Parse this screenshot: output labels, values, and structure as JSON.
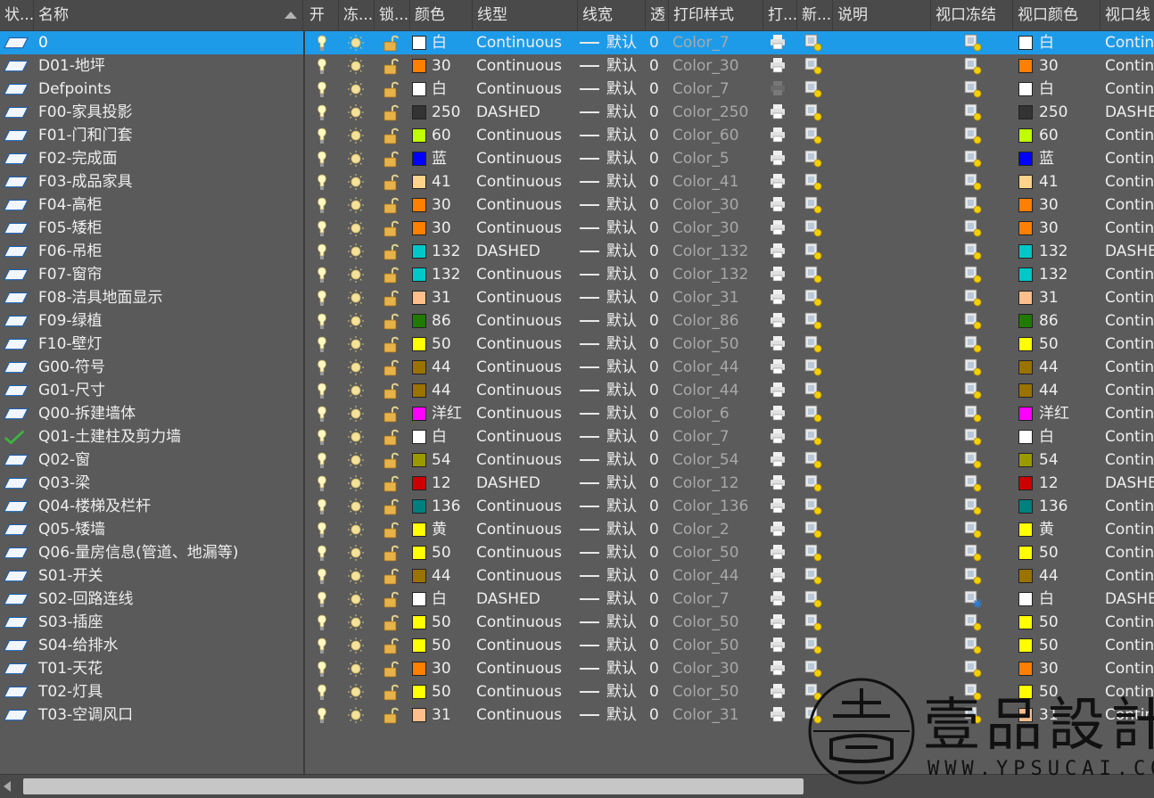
{
  "columns": {
    "status": "状...",
    "name": "名称",
    "on": "开",
    "freeze": "冻...",
    "lock": "锁...",
    "color": "颜色",
    "linetype": "线型",
    "lineweight": "线宽",
    "transparency": "透",
    "plot_style": "打印样式",
    "plot": "打...",
    "new_vp_freeze": "新...",
    "description": "说明",
    "vp_freeze": "视口冻结",
    "vp_color": "视口颜色",
    "vp_linetype": "视口线"
  },
  "layers": [
    {
      "name": "0",
      "color_label": "白",
      "hex": "#ffffff",
      "linetype": "Continuous",
      "lineweight": "默认",
      "transparency": "0",
      "plot_style": "Color_7",
      "vp_color_label": "白",
      "vp_linetype": "Contin",
      "selected": true
    },
    {
      "name": "D01-地坪",
      "color_label": "30",
      "hex": "#ff7f00",
      "linetype": "Continuous",
      "lineweight": "默认",
      "transparency": "0",
      "plot_style": "Color_30",
      "vp_color_label": "30",
      "vp_linetype": "Contin"
    },
    {
      "name": "Defpoints",
      "color_label": "白",
      "hex": "#ffffff",
      "linetype": "Continuous",
      "lineweight": "默认",
      "transparency": "0",
      "plot_style": "Color_7",
      "vp_color_label": "白",
      "vp_linetype": "Contin",
      "no_plot": true
    },
    {
      "name": "F00-家具投影",
      "color_label": "250",
      "hex": "#333333",
      "linetype": "DASHED",
      "lineweight": "默认",
      "transparency": "0",
      "plot_style": "Color_250",
      "vp_color_label": "250",
      "vp_linetype": "DASHE"
    },
    {
      "name": "F01-门和门套",
      "color_label": "60",
      "hex": "#bfff00",
      "linetype": "Continuous",
      "lineweight": "默认",
      "transparency": "0",
      "plot_style": "Color_60",
      "vp_color_label": "60",
      "vp_linetype": "Contin"
    },
    {
      "name": "F02-完成面",
      "color_label": "蓝",
      "hex": "#0000ff",
      "linetype": "Continuous",
      "lineweight": "默认",
      "transparency": "0",
      "plot_style": "Color_5",
      "vp_color_label": "蓝",
      "vp_linetype": "Contin"
    },
    {
      "name": "F03-成品家具",
      "color_label": "41",
      "hex": "#ffd38a",
      "linetype": "Continuous",
      "lineweight": "默认",
      "transparency": "0",
      "plot_style": "Color_41",
      "vp_color_label": "41",
      "vp_linetype": "Contin"
    },
    {
      "name": "F04-高柜",
      "color_label": "30",
      "hex": "#ff7f00",
      "linetype": "Continuous",
      "lineweight": "默认",
      "transparency": "0",
      "plot_style": "Color_30",
      "vp_color_label": "30",
      "vp_linetype": "Contin"
    },
    {
      "name": "F05-矮柜",
      "color_label": "30",
      "hex": "#ff7f00",
      "linetype": "Continuous",
      "lineweight": "默认",
      "transparency": "0",
      "plot_style": "Color_30",
      "vp_color_label": "30",
      "vp_linetype": "Contin"
    },
    {
      "name": "F06-吊柜",
      "color_label": "132",
      "hex": "#00c8c8",
      "linetype": "DASHED",
      "lineweight": "默认",
      "transparency": "0",
      "plot_style": "Color_132",
      "vp_color_label": "132",
      "vp_linetype": "DASHE"
    },
    {
      "name": "F07-窗帘",
      "color_label": "132",
      "hex": "#00c8c8",
      "linetype": "Continuous",
      "lineweight": "默认",
      "transparency": "0",
      "plot_style": "Color_132",
      "vp_color_label": "132",
      "vp_linetype": "Contin"
    },
    {
      "name": "F08-洁具地面显示",
      "color_label": "31",
      "hex": "#ffbf8c",
      "linetype": "Continuous",
      "lineweight": "默认",
      "transparency": "0",
      "plot_style": "Color_31",
      "vp_color_label": "31",
      "vp_linetype": "Contin"
    },
    {
      "name": "F09-绿植",
      "color_label": "86",
      "hex": "#207a00",
      "linetype": "Continuous",
      "lineweight": "默认",
      "transparency": "0",
      "plot_style": "Color_86",
      "vp_color_label": "86",
      "vp_linetype": "Contin"
    },
    {
      "name": "F10-壁灯",
      "color_label": "50",
      "hex": "#ffff00",
      "linetype": "Continuous",
      "lineweight": "默认",
      "transparency": "0",
      "plot_style": "Color_50",
      "vp_color_label": "50",
      "vp_linetype": "Contin"
    },
    {
      "name": "G00-符号",
      "color_label": "44",
      "hex": "#9a7200",
      "linetype": "Continuous",
      "lineweight": "默认",
      "transparency": "0",
      "plot_style": "Color_44",
      "vp_color_label": "44",
      "vp_linetype": "Contin"
    },
    {
      "name": "G01-尺寸",
      "color_label": "44",
      "hex": "#9a7200",
      "linetype": "Continuous",
      "lineweight": "默认",
      "transparency": "0",
      "plot_style": "Color_44",
      "vp_color_label": "44",
      "vp_linetype": "Contin"
    },
    {
      "name": "Q00-拆建墙体",
      "color_label": "洋红",
      "hex": "#ff00ff",
      "linetype": "Continuous",
      "lineweight": "默认",
      "transparency": "0",
      "plot_style": "Color_6",
      "vp_color_label": "洋红",
      "vp_linetype": "Contin"
    },
    {
      "name": "Q01-土建柱及剪力墙",
      "color_label": "白",
      "hex": "#ffffff",
      "linetype": "Continuous",
      "lineweight": "默认",
      "transparency": "0",
      "plot_style": "Color_7",
      "vp_color_label": "白",
      "vp_linetype": "Contin",
      "current": true
    },
    {
      "name": "Q02-窗",
      "color_label": "54",
      "hex": "#9a9a00",
      "linetype": "Continuous",
      "lineweight": "默认",
      "transparency": "0",
      "plot_style": "Color_54",
      "vp_color_label": "54",
      "vp_linetype": "Contin"
    },
    {
      "name": "Q03-梁",
      "color_label": "12",
      "hex": "#cc0000",
      "linetype": "DASHED",
      "lineweight": "默认",
      "transparency": "0",
      "plot_style": "Color_12",
      "vp_color_label": "12",
      "vp_linetype": "DASHE"
    },
    {
      "name": "Q04-楼梯及栏杆",
      "color_label": "136",
      "hex": "#007f7f",
      "linetype": "Continuous",
      "lineweight": "默认",
      "transparency": "0",
      "plot_style": "Color_136",
      "vp_color_label": "136",
      "vp_linetype": "Contin"
    },
    {
      "name": "Q05-矮墙",
      "color_label": "黄",
      "hex": "#ffff00",
      "linetype": "Continuous",
      "lineweight": "默认",
      "transparency": "0",
      "plot_style": "Color_2",
      "vp_color_label": "黄",
      "vp_linetype": "Contin"
    },
    {
      "name": "Q06-量房信息(管道、地漏等)",
      "color_label": "50",
      "hex": "#ffff00",
      "linetype": "Continuous",
      "lineweight": "默认",
      "transparency": "0",
      "plot_style": "Color_50",
      "vp_color_label": "50",
      "vp_linetype": "Contin"
    },
    {
      "name": "S01-开关",
      "color_label": "44",
      "hex": "#9a7200",
      "linetype": "Continuous",
      "lineweight": "默认",
      "transparency": "0",
      "plot_style": "Color_44",
      "vp_color_label": "44",
      "vp_linetype": "Contin"
    },
    {
      "name": "S02-回路连线",
      "color_label": "白",
      "hex": "#ffffff",
      "linetype": "DASHED",
      "lineweight": "默认",
      "transparency": "0",
      "plot_style": "Color_7",
      "vp_color_label": "白",
      "vp_linetype": "DASHE",
      "vp_frozen": true
    },
    {
      "name": "S03-插座",
      "color_label": "50",
      "hex": "#ffff00",
      "linetype": "Continuous",
      "lineweight": "默认",
      "transparency": "0",
      "plot_style": "Color_50",
      "vp_color_label": "50",
      "vp_linetype": "Contin"
    },
    {
      "name": "S04-给排水",
      "color_label": "50",
      "hex": "#ffff00",
      "linetype": "Continuous",
      "lineweight": "默认",
      "transparency": "0",
      "plot_style": "Color_50",
      "vp_color_label": "50",
      "vp_linetype": "Contin"
    },
    {
      "name": "T01-天花",
      "color_label": "30",
      "hex": "#ff7f00",
      "linetype": "Continuous",
      "lineweight": "默认",
      "transparency": "0",
      "plot_style": "Color_30",
      "vp_color_label": "30",
      "vp_linetype": "Contin"
    },
    {
      "name": "T02-灯具",
      "color_label": "50",
      "hex": "#ffff00",
      "linetype": "Continuous",
      "lineweight": "默认",
      "transparency": "0",
      "plot_style": "Color_50",
      "vp_color_label": "50",
      "vp_linetype": "Contin"
    },
    {
      "name": "T03-空调风口",
      "color_label": "31",
      "hex": "#ffbf8c",
      "linetype": "Continuous",
      "lineweight": "默认",
      "transparency": "0",
      "plot_style": "Color_31",
      "vp_color_label": "31",
      "vp_linetype": "Contin"
    }
  ],
  "watermark": {
    "title": "壹品設計",
    "url": "WWW.YPSUCAI.COM",
    "seal_char": "壹"
  },
  "colors": {
    "selection": "#1e9be8",
    "background": "#595959",
    "header": "#4a4a4a"
  }
}
